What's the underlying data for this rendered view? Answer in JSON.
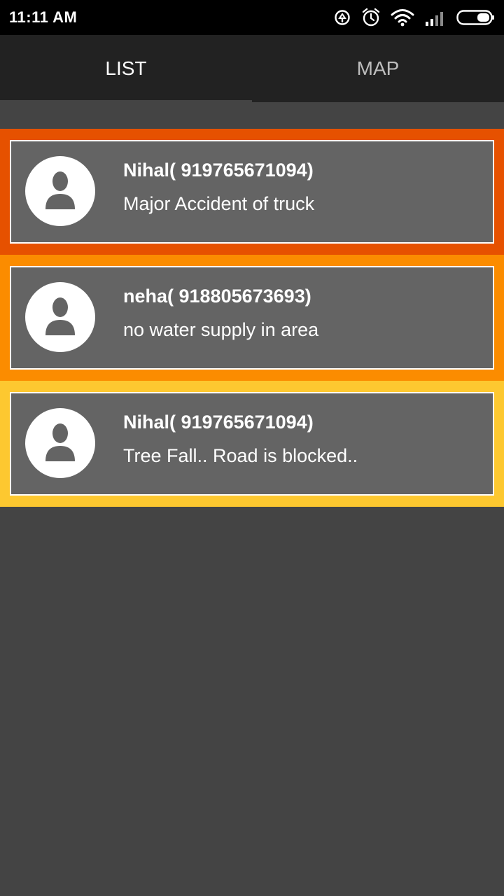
{
  "status_bar": {
    "time": "11:11 AM",
    "icons": [
      "sync-icon",
      "alarm-icon",
      "wifi-icon",
      "signal-icon",
      "battery-icon"
    ]
  },
  "tabs": [
    {
      "label": "LIST",
      "selected": true
    },
    {
      "label": "MAP",
      "selected": false
    }
  ],
  "colors": {
    "status_bar_bg": "#000000",
    "tab_bar_bg": "#222222",
    "page_bg": "#444444",
    "card_bg": "#646464",
    "priority_high": "#e65100",
    "priority_medium": "#fb8c00",
    "priority_low": "#fdc830"
  },
  "reports": [
    {
      "title": "Nihal( 919765671094)",
      "text": "Major Accident of truck",
      "color": "#e65100"
    },
    {
      "title": "neha( 918805673693)",
      "text": "no water supply in area",
      "color": "#fb8c00"
    },
    {
      "title": "Nihal( 919765671094)",
      "text": "Tree Fall.. Road is blocked..",
      "color": "#fdc830"
    }
  ]
}
